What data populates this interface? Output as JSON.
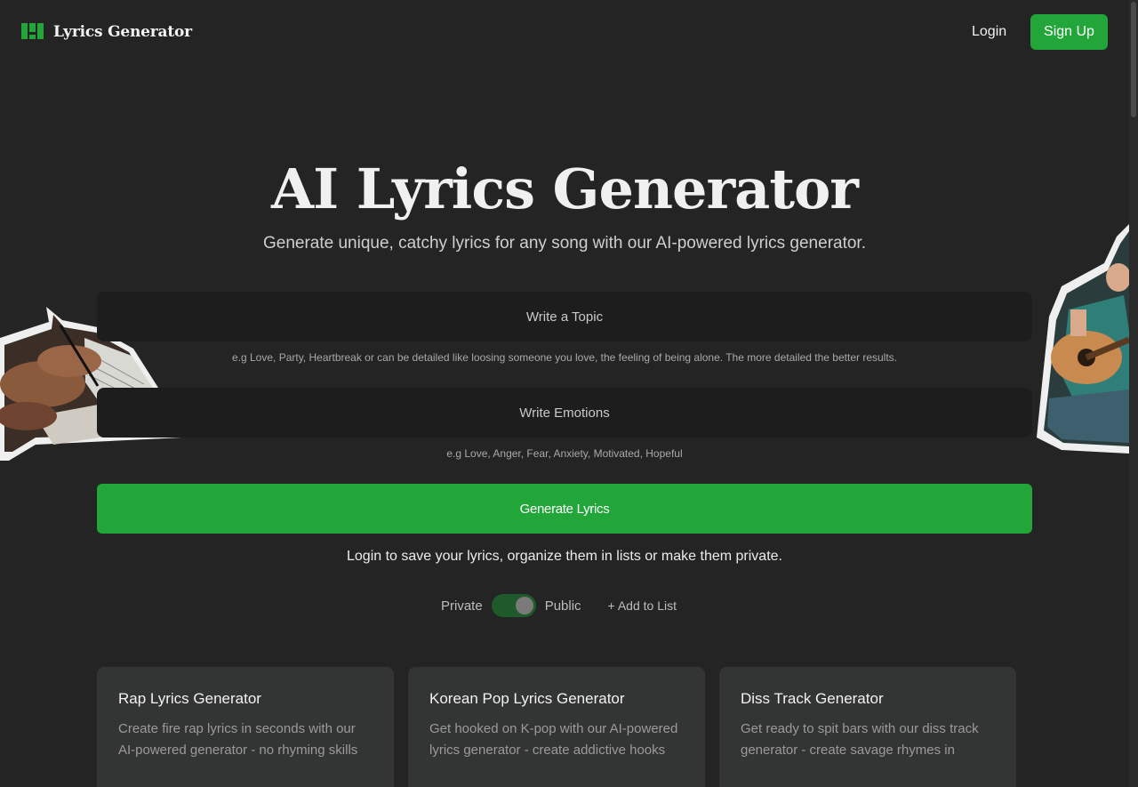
{
  "header": {
    "logo_text": "Lyrics Generator",
    "login_label": "Login",
    "signup_label": "Sign Up"
  },
  "hero": {
    "title": "AI Lyrics Generator",
    "subtitle": "Generate unique, catchy lyrics for any song with our AI-powered lyrics generator."
  },
  "form": {
    "topic_placeholder": "Write a Topic",
    "topic_value": "",
    "topic_hint": "e.g Love, Party, Heartbreak or can be detailed like loosing someone you love, the feeling of being alone. The more detailed the better results.",
    "emotions_placeholder": "Write Emotions",
    "emotions_value": "",
    "emotions_hint": "e.g Love, Anger, Fear, Anxiety, Motivated, Hopeful",
    "generate_label": "Generate Lyrics",
    "login_note": "Login to save your lyrics, organize them in lists or make them private.",
    "private_label": "Private",
    "public_label": "Public",
    "add_to_list_label": "+ Add to List"
  },
  "cards": [
    {
      "title": "Rap Lyrics Generator",
      "desc": "Create fire rap lyrics in seconds with our AI-powered generator - no rhyming skills"
    },
    {
      "title": "Korean Pop Lyrics Generator",
      "desc": "Get hooked on K-pop with our AI-powered lyrics generator - create addictive hooks"
    },
    {
      "title": "Diss Track Generator",
      "desc": "Get ready to spit bars with our diss track generator - create savage rhymes in"
    }
  ],
  "colors": {
    "background": "#242424",
    "accent": "#22a63a",
    "input_bg": "#1d1d1d",
    "card_bg": "#333434"
  }
}
